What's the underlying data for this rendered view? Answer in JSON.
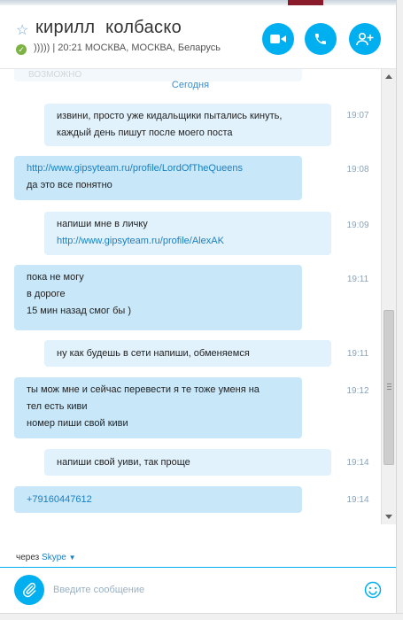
{
  "header": {
    "star_icon": "☆",
    "contact_name": "кирилл  колбаско",
    "status_text": "))))) | 20:21 МОСКВА, МОСКВА, Беларусь",
    "buttons": {
      "video": "video-icon",
      "call": "phone-icon",
      "add_contact": "add-person-icon"
    }
  },
  "chat": {
    "faded_text": "ВОЗМОЖНО",
    "date_divider": "Сегодня",
    "messages": [
      {
        "dir": "out",
        "lines": [
          "извини, просто уже кидальщики пытались кинуть,",
          "каждый день пишут после моего поста"
        ],
        "time": "19:07"
      },
      {
        "dir": "in",
        "link": "http://www.gipsyteam.ru/profile/LordOfTheQueens",
        "lines": [
          "да это все понятно"
        ],
        "time": "19:08"
      },
      {
        "dir": "out",
        "lines": [
          "напиши мне в личку"
        ],
        "link": "http://www.gipsyteam.ru/profile/AlexAK",
        "time": "19:09"
      },
      {
        "dir": "in",
        "lines": [
          "пока не могу",
          "в дороге",
          "15 мин назад смог бы )"
        ],
        "time": "19:11"
      },
      {
        "dir": "out",
        "lines": [
          "ну как будешь в сети напиши, обменяемся"
        ],
        "time": "19:11"
      },
      {
        "dir": "in",
        "lines": [
          "ты мож мне и сейчас перевести я те тоже уменя на",
          "тел есть киви",
          "номер пиши свой киви"
        ],
        "time": "19:12"
      },
      {
        "dir": "out",
        "lines": [
          "напиши свой уиви, так проще"
        ],
        "time": "19:14"
      },
      {
        "dir": "in",
        "link": "+79160447612",
        "time": "19:14"
      }
    ]
  },
  "footer": {
    "via_prefix": "через",
    "via_link": "Skype",
    "via_caret": "▼",
    "placeholder": "Введите сообщение"
  },
  "colors": {
    "accent": "#00aff0",
    "bubble_in": "#c8e8fa",
    "bubble_out": "#e1f2fc",
    "link": "#1a7fc1",
    "online": "#7cb342"
  }
}
